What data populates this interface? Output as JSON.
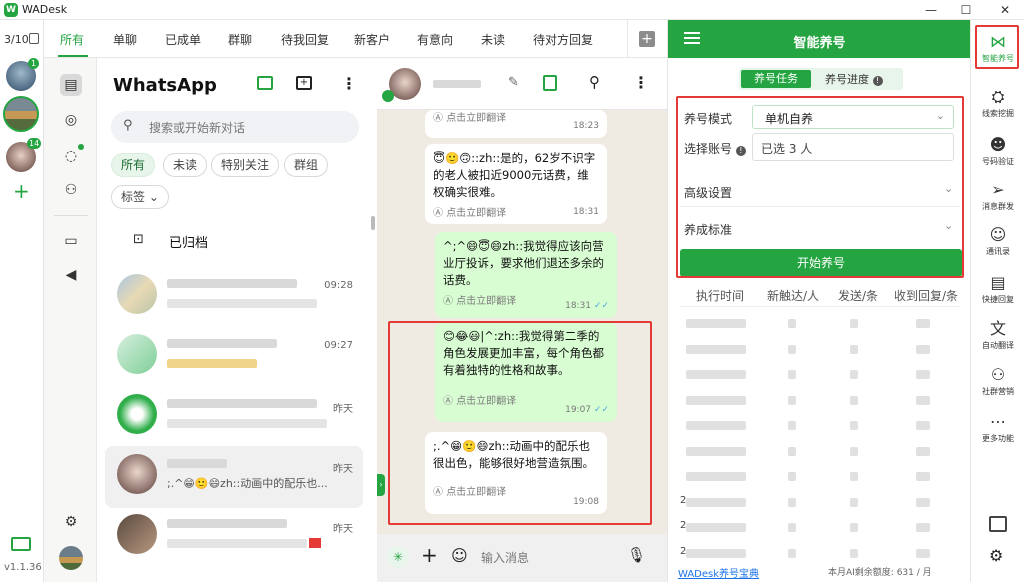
{
  "window": {
    "title": "WADesk",
    "logo_letter": "W"
  },
  "rail": {
    "counter": "3/10",
    "badges": [
      "1",
      "14"
    ],
    "version": "v1.1.36"
  },
  "tabs": [
    "所有",
    "单聊",
    "已成单",
    "群聊",
    "待我回复",
    "新客户",
    "有意向",
    "未读",
    "待对方回复"
  ],
  "chatlist": {
    "title": "WhatsApp",
    "search_placeholder": "搜索或开始新对话",
    "filters": [
      "所有",
      "未读",
      "特别关注",
      "群组"
    ],
    "label_filter": "标签",
    "archived": "已归档",
    "rows": [
      {
        "time": "09:28",
        "preview": ""
      },
      {
        "time": "09:27",
        "preview": ""
      },
      {
        "time": "昨天",
        "preview": ""
      },
      {
        "time": "昨天",
        "preview": ";.^😁🙂😄zh::动画中的配乐也..."
      },
      {
        "time": "昨天",
        "preview": ""
      }
    ]
  },
  "conversation": {
    "translate_label": "点击立即翻译",
    "composer_placeholder": "输入消息",
    "messages": [
      {
        "dir": "in",
        "text": "",
        "time": "18:23"
      },
      {
        "dir": "in",
        "text": "😇🙂🙃::zh::是的，62岁不识字的老人被扣近9000元话费，维权确实很难。",
        "time": "18:31"
      },
      {
        "dir": "out",
        "text": "^;^😄😇😄zh::我觉得应该向营业厅投诉，要求他们退还多余的话费。",
        "time": "18:31"
      },
      {
        "dir": "out",
        "text": "😊😂😃|^:zh::我觉得第二季的角色发展更加丰富，每个角色都有着独特的性格和故事。",
        "time": "19:07"
      },
      {
        "dir": "in",
        "text": ";.^😁🙂😄zh::动画中的配乐也很出色，能够很好地营造氛围。",
        "time": "19:08"
      }
    ]
  },
  "panel": {
    "title": "智能养号",
    "tab_task": "养号任务",
    "tab_progress": "养号进度",
    "mode_label": "养号模式",
    "mode_value": "单机自养",
    "account_label": "选择账号",
    "account_value": "已选 3 人",
    "advanced": "高级设置",
    "standard": "养成标准",
    "start_button": "开始养号",
    "table_headers": [
      "执行时间",
      "新触达/人",
      "发送/条",
      "收到回复/条"
    ],
    "row_marks": [
      "",
      "",
      "",
      "",
      "",
      "",
      "",
      "2",
      "2",
      "2"
    ],
    "footer_link": "WADesk养号宝典",
    "footer_quota": "本月AI剩余额度: 631 / 月"
  },
  "right_sidebar": [
    {
      "label": "智能养号",
      "icon": "share-nodes-icon"
    },
    {
      "label": "线索挖掘",
      "icon": "mining-icon"
    },
    {
      "label": "号码验证",
      "icon": "verify-user-icon"
    },
    {
      "label": "消息群发",
      "icon": "paper-plane-icon"
    },
    {
      "label": "通讯录",
      "icon": "contacts-icon"
    },
    {
      "label": "快捷回复",
      "icon": "quick-reply-icon"
    },
    {
      "label": "自动翻译",
      "icon": "translate-icon"
    },
    {
      "label": "社群营销",
      "icon": "community-icon"
    },
    {
      "label": "更多功能",
      "icon": "more-icon"
    }
  ],
  "colors": {
    "brand": "#25a541",
    "highlight": "#e53935",
    "bubble_out": "#d9fdd3",
    "chat_bg": "#efeae2"
  }
}
